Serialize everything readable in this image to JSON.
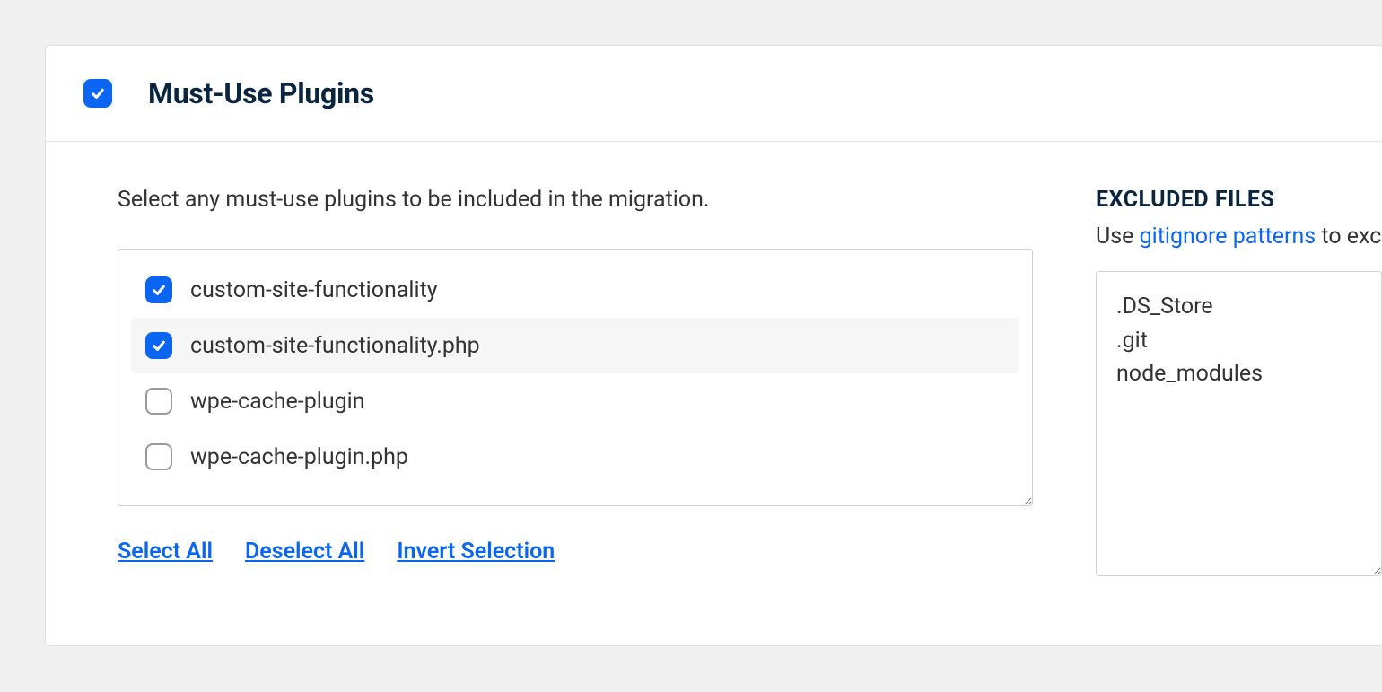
{
  "section": {
    "title": "Must-Use Plugins",
    "main_checked": true,
    "description": "Select any must-use plugins to be included in the migration."
  },
  "plugins": [
    {
      "label": "custom-site-functionality",
      "checked": true,
      "hovered": false
    },
    {
      "label": "custom-site-functionality.php",
      "checked": true,
      "hovered": true
    },
    {
      "label": "wpe-cache-plugin",
      "checked": false,
      "hovered": false
    },
    {
      "label": "wpe-cache-plugin.php",
      "checked": false,
      "hovered": false
    }
  ],
  "actions": {
    "select_all": "Select All",
    "deselect_all": "Deselect All",
    "invert_selection": "Invert Selection"
  },
  "excluded": {
    "title": "EXCLUDED FILES",
    "desc_prefix": "Use ",
    "desc_link": "gitignore patterns",
    "desc_suffix": " to exclu",
    "textarea_value": ".DS_Store\n.git\nnode_modules"
  }
}
